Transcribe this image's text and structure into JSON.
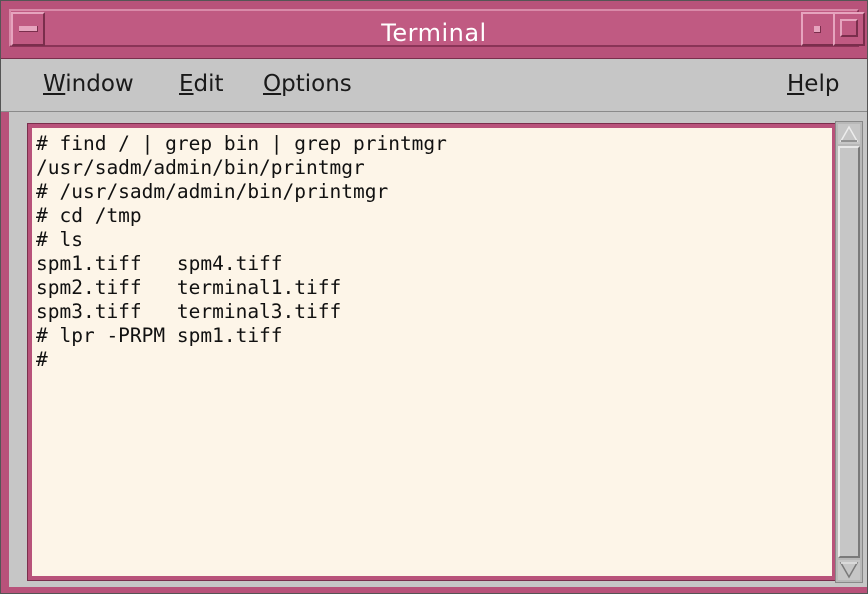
{
  "window": {
    "title": "Terminal",
    "accent_color": "#b8527a"
  },
  "menubar": {
    "items": [
      {
        "label": "Window",
        "mnemonic": "W",
        "rest": "indow"
      },
      {
        "label": "Edit",
        "mnemonic": "E",
        "rest": "dit"
      },
      {
        "label": "Options",
        "mnemonic": "O",
        "rest": "ptions"
      },
      {
        "label": "Help",
        "mnemonic": "H",
        "rest": "elp"
      }
    ]
  },
  "terminal": {
    "background": "#fdf5e8",
    "lines": [
      "# find / | grep bin | grep printmgr",
      "/usr/sadm/admin/bin/printmgr",
      "# /usr/sadm/admin/bin/printmgr",
      "# cd /tmp",
      "# ls",
      "spm1.tiff   spm4.tiff",
      "spm2.tiff   terminal1.tiff",
      "spm3.tiff   terminal3.tiff",
      "# lpr -PRPM spm1.tiff",
      "#"
    ]
  },
  "icons": {
    "window_menu": "window-menu-icon",
    "minimize": "minimize-icon",
    "maximize": "maximize-icon",
    "scroll_up": "scroll-up-arrow-icon",
    "scroll_down": "scroll-down-arrow-icon"
  }
}
